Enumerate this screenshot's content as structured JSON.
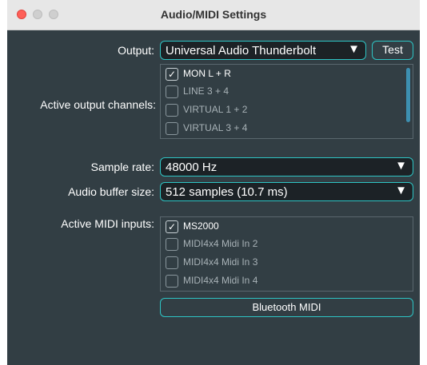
{
  "window": {
    "title": "Audio/MIDI Settings"
  },
  "output": {
    "label": "Output:",
    "value": "Universal Audio Thunderbolt",
    "test_label": "Test"
  },
  "active_output_channels": {
    "label": "Active output channels:",
    "items": [
      {
        "label": "MON L + R",
        "checked": true
      },
      {
        "label": "LINE 3 + 4",
        "checked": false
      },
      {
        "label": "VIRTUAL 1 + 2",
        "checked": false
      },
      {
        "label": "VIRTUAL 3 + 4",
        "checked": false
      }
    ]
  },
  "sample_rate": {
    "label": "Sample rate:",
    "value": "48000 Hz"
  },
  "buffer_size": {
    "label": "Audio buffer size:",
    "value": "512 samples (10.7 ms)"
  },
  "midi_inputs": {
    "label": "Active MIDI inputs:",
    "items": [
      {
        "label": "MS2000",
        "checked": true
      },
      {
        "label": "MIDI4x4 Midi In 2",
        "checked": false
      },
      {
        "label": "MIDI4x4 Midi In 3",
        "checked": false
      },
      {
        "label": "MIDI4x4 Midi In 4",
        "checked": false
      }
    ]
  },
  "bluetooth": {
    "label": "Bluetooth MIDI"
  },
  "icons": {
    "dropdown": "triangle-down",
    "check": "checkmark"
  },
  "colors": {
    "accent": "#2ec4c4",
    "background": "#323e44",
    "close": "#fe5f57"
  }
}
